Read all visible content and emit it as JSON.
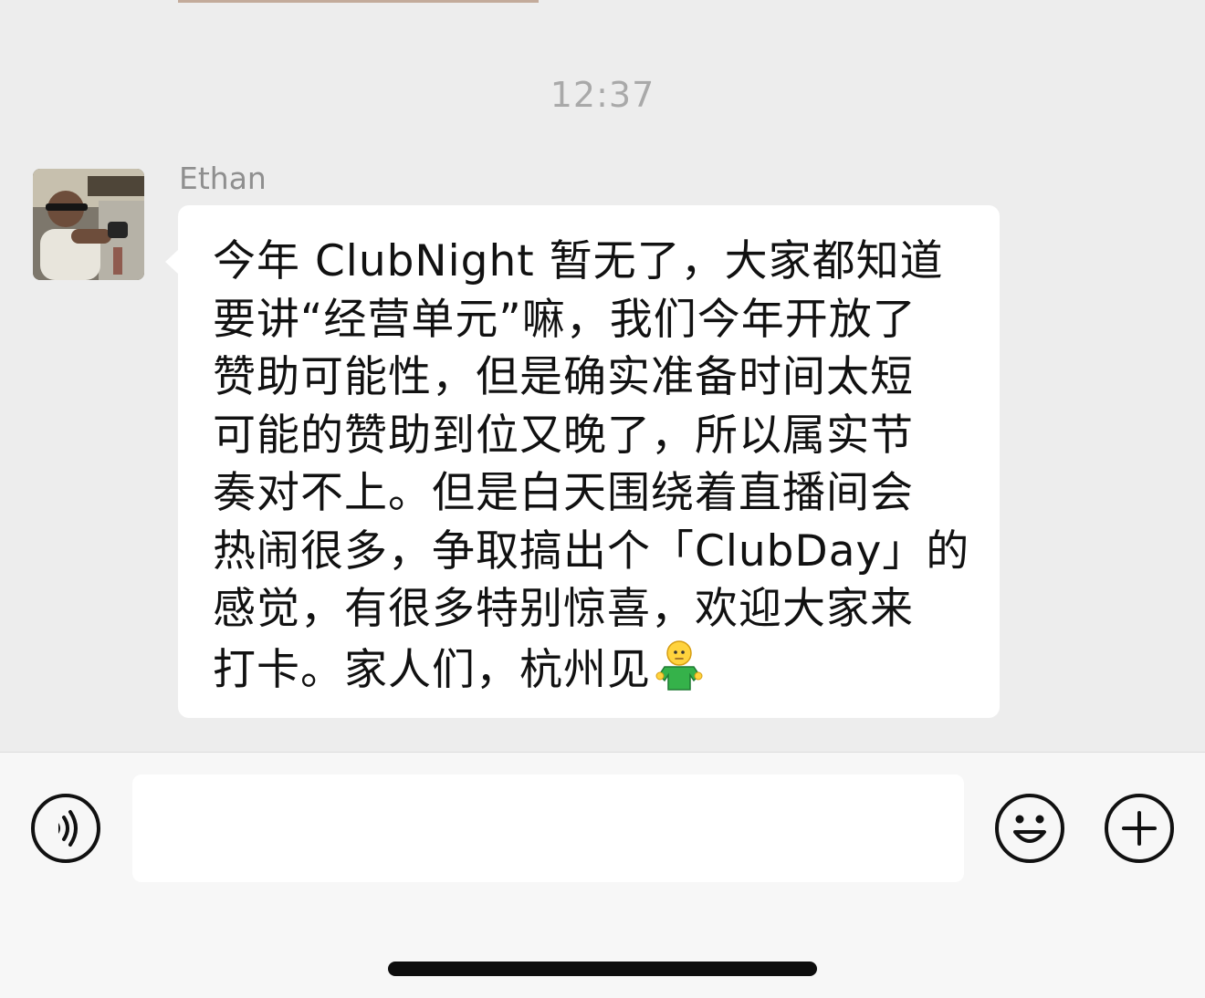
{
  "chat": {
    "timestamp": "12:37",
    "message": {
      "sender": "Ethan",
      "lines": [
        "今年 ClubNight 暂无了，大家都知道",
        "要讲“经营单元”嘛，我们今年开放了",
        "赞助可能性，但是确实准备时间太短",
        "可能的赞助到位又晚了，所以属实节",
        "奏对不上。但是白天围绕着直播间会",
        "热闹很多，争取搞出个「ClubDay」的",
        "感觉，有很多特别惊喜，欢迎大家来",
        "打卡。家人们，杭州见"
      ],
      "trailing_emoji": "person-shrugging-emoji"
    }
  },
  "input_bar": {
    "voice_icon": "voice-icon",
    "text_value": "",
    "emoji_icon": "smiley-face-icon",
    "more_icon": "plus-icon"
  },
  "colors": {
    "chat_background": "#ededed",
    "bubble_background": "#ffffff",
    "input_bar_background": "#f7f7f7",
    "timestamp_text": "#a9a9a9"
  }
}
